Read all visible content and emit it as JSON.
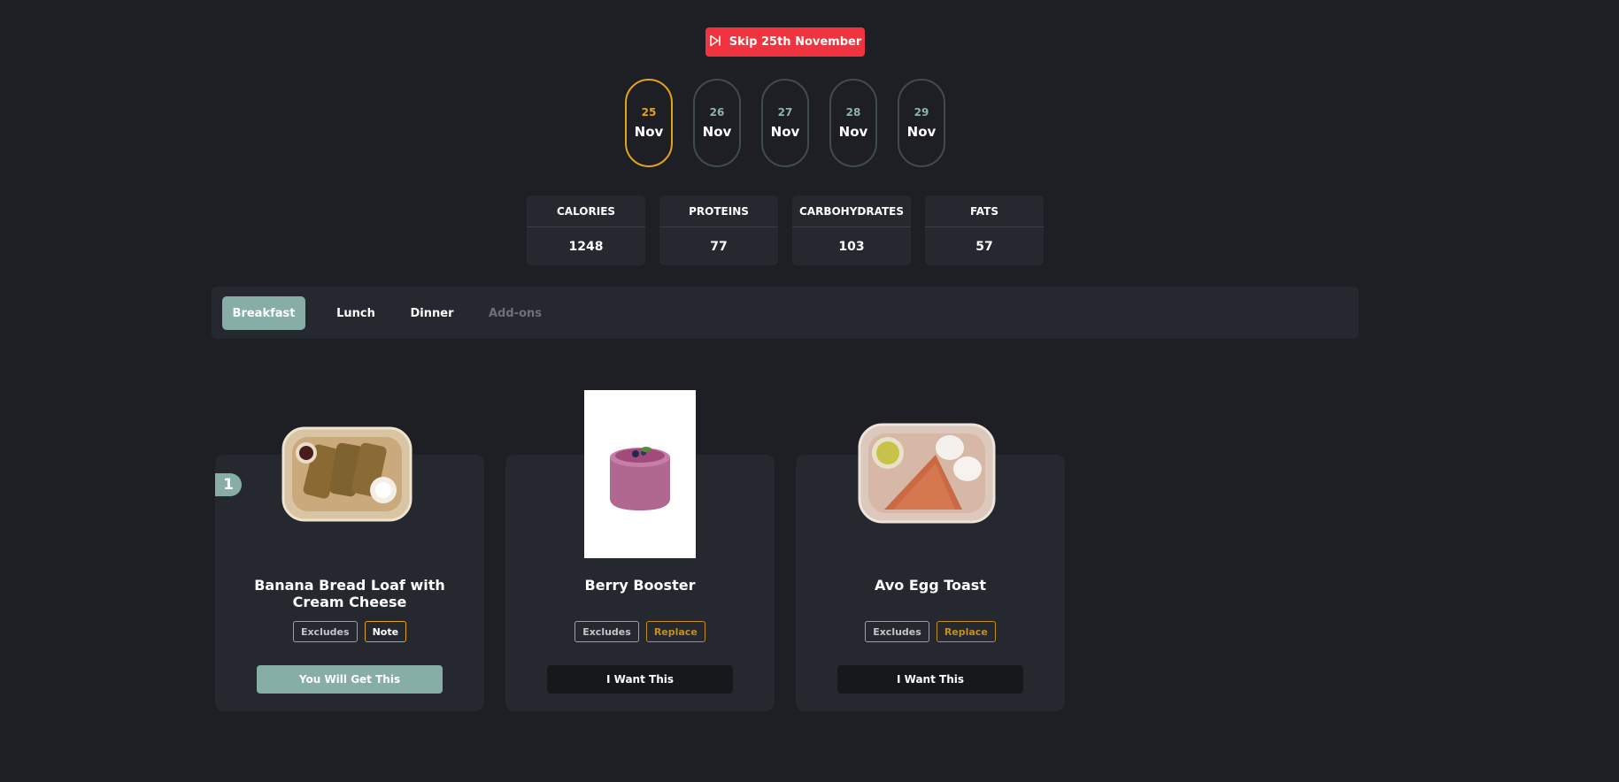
{
  "skip": {
    "label": "Skip 25th November",
    "color": "#f0343f"
  },
  "dates": [
    {
      "day": "25",
      "month": "Nov",
      "active": true
    },
    {
      "day": "26",
      "month": "Nov"
    },
    {
      "day": "27",
      "month": "Nov"
    },
    {
      "day": "28",
      "month": "Nov"
    },
    {
      "day": "29",
      "month": "Nov"
    }
  ],
  "macros": [
    {
      "label": "CALORIES",
      "value": "1248"
    },
    {
      "label": "PROTEINS",
      "value": "77"
    },
    {
      "label": "CARBOHYDRATES",
      "value": "103"
    },
    {
      "label": "FATS",
      "value": "57"
    }
  ],
  "tabs": [
    {
      "label": "Breakfast",
      "state": "active"
    },
    {
      "label": "Lunch"
    },
    {
      "label": "Dinner"
    },
    {
      "label": "Add-ons",
      "state": "disabled"
    }
  ],
  "cards": [
    {
      "badge": "1",
      "name": "Banana Bread Loaf with Cream Cheese",
      "tags": [
        "Excludes",
        "Note"
      ],
      "action": "You Will Get This"
    },
    {
      "name": "Berry Booster",
      "tags": [
        "Excludes",
        "Replace"
      ],
      "action": "I Want This"
    },
    {
      "name": "Avo Egg Toast",
      "tags": [
        "Excludes",
        "Replace"
      ],
      "action": "I Want This"
    }
  ],
  "colors": {
    "accent": "#86aea6",
    "highlight": "#e3a21e",
    "background": "#1e1f24"
  },
  "icons": {
    "skip": "skip-forward-icon"
  }
}
